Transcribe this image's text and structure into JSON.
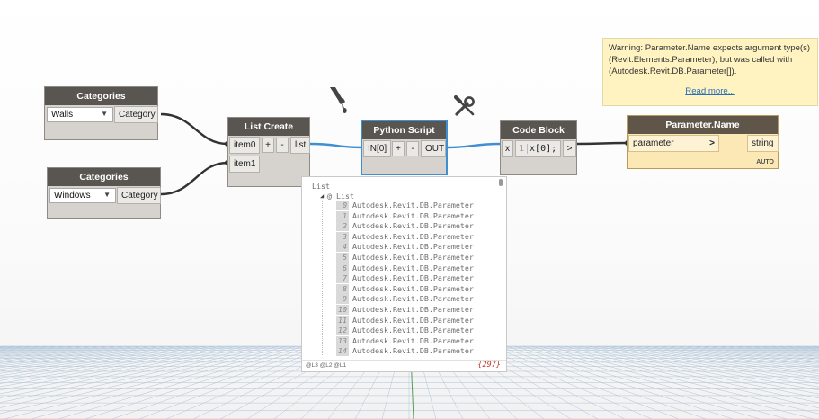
{
  "nodes": {
    "categories_walls": {
      "title": "Categories",
      "selected": "Walls",
      "output": "Category"
    },
    "categories_windows": {
      "title": "Categories",
      "selected": "Windows",
      "output": "Category"
    },
    "list_create": {
      "title": "List Create",
      "inputs": [
        "item0",
        "item1"
      ],
      "add_label": "+",
      "remove_label": "-",
      "output": "list"
    },
    "python_script": {
      "title": "Python Script",
      "input": "IN[0]",
      "add_label": "+",
      "remove_label": "-",
      "output": "OUT"
    },
    "code_block": {
      "title": "Code Block",
      "input": "x",
      "line_number": "1",
      "code": "x[0];",
      "output": ">"
    },
    "parameter_name": {
      "title": "Parameter.Name",
      "input": "parameter",
      "input_arrow": ">",
      "output": "string",
      "lacing": "AUTO"
    }
  },
  "warning": {
    "text": "Warning: Parameter.Name expects argument type(s) (Revit.Elements.Parameter), but was called with (Autodesk.Revit.DB.Parameter[]).",
    "link": "Read more..."
  },
  "preview": {
    "root_label": "List",
    "sublist_label": "@ List",
    "items": [
      {
        "index": "0",
        "value": "Autodesk.Revit.DB.Parameter"
      },
      {
        "index": "1",
        "value": "Autodesk.Revit.DB.Parameter"
      },
      {
        "index": "2",
        "value": "Autodesk.Revit.DB.Parameter"
      },
      {
        "index": "3",
        "value": "Autodesk.Revit.DB.Parameter"
      },
      {
        "index": "4",
        "value": "Autodesk.Revit.DB.Parameter"
      },
      {
        "index": "5",
        "value": "Autodesk.Revit.DB.Parameter"
      },
      {
        "index": "6",
        "value": "Autodesk.Revit.DB.Parameter"
      },
      {
        "index": "7",
        "value": "Autodesk.Revit.DB.Parameter"
      },
      {
        "index": "8",
        "value": "Autodesk.Revit.DB.Parameter"
      },
      {
        "index": "9",
        "value": "Autodesk.Revit.DB.Parameter"
      },
      {
        "index": "10",
        "value": "Autodesk.Revit.DB.Parameter"
      },
      {
        "index": "11",
        "value": "Autodesk.Revit.DB.Parameter"
      },
      {
        "index": "12",
        "value": "Autodesk.Revit.DB.Parameter"
      },
      {
        "index": "13",
        "value": "Autodesk.Revit.DB.Parameter"
      },
      {
        "index": "14",
        "value": "Autodesk.Revit.DB.Parameter"
      }
    ],
    "levels": "@L3 @L2 @L1",
    "count": "{297}"
  },
  "icons": {
    "freeze": "pipette-icon",
    "edit": "wrench-screwdriver-icon"
  },
  "colors": {
    "node_header": "#595550",
    "node_body": "#d6d3cf",
    "wire_blue": "#3f8fd2",
    "wire_dark": "#333333",
    "warning_header": "#5f5548",
    "warning_body": "#fbe8b4",
    "warning_popup": "#fff4c1",
    "link": "#2c6fb2",
    "selection": "#3f8fd2"
  }
}
